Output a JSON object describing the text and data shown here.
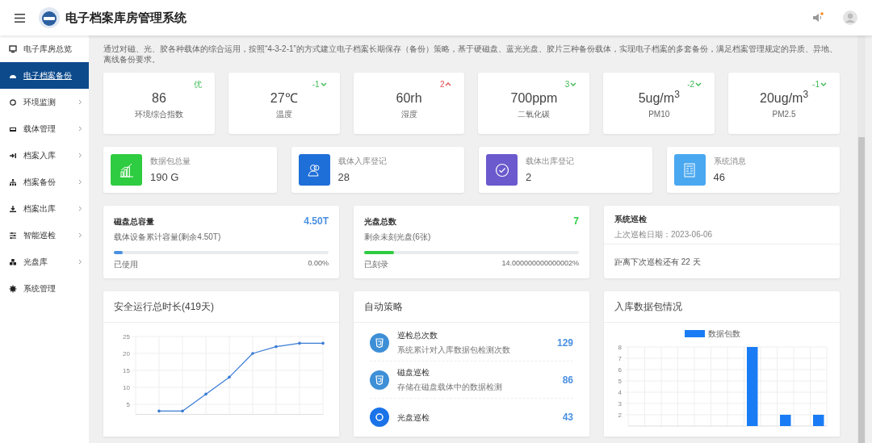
{
  "header": {
    "title": "电子档案库房管理系统"
  },
  "sidebar": {
    "items": [
      {
        "label": "电子库房总览",
        "selected": false,
        "submenu": false
      },
      {
        "label": "电子档案备份",
        "selected": true,
        "submenu": false
      },
      {
        "label": "环境监测",
        "selected": false,
        "submenu": true
      },
      {
        "label": "载体管理",
        "selected": false,
        "submenu": true
      },
      {
        "label": "档案入库",
        "selected": false,
        "submenu": true
      },
      {
        "label": "档案备份",
        "selected": false,
        "submenu": true
      },
      {
        "label": "档案出库",
        "selected": false,
        "submenu": true
      },
      {
        "label": "智能巡检",
        "selected": false,
        "submenu": true
      },
      {
        "label": "光盘库",
        "selected": false,
        "submenu": true
      },
      {
        "label": "系统管理",
        "selected": false,
        "submenu": false
      }
    ]
  },
  "intro": "通过对磁、光、胶各种载体的综合运用，按照“4-3-2-1”的方式建立电子档案长期保存（备份）策略，基于硬磁盘、蓝光光盘、胶片三种备份载体，实现电子档案的多套备份，满足档案管理规定的异质、异地、离线备份要求。",
  "env_cards": [
    {
      "value": "86",
      "label": "环境综合指数",
      "change": "优",
      "kind": "none"
    },
    {
      "value": "27℃",
      "label": "温度",
      "change": "-1",
      "kind": "down"
    },
    {
      "value": "60rh",
      "label": "湿度",
      "change": "2",
      "kind": "up"
    },
    {
      "value": "700ppm",
      "label": "二氧化碳",
      "change": "3",
      "kind": "down"
    },
    {
      "value": "5ug/m$^{3}$",
      "label": "PM10",
      "change": "-2",
      "kind": "down"
    },
    {
      "value": "20ug/m$^{3}$",
      "label": "PM2.5",
      "change": "-1",
      "kind": "down"
    }
  ],
  "stat_cards": [
    {
      "label": "数据包总量",
      "value": "190 G",
      "color": "#2ecc40"
    },
    {
      "label": "载体入库登记",
      "value": "28",
      "color": "#1f6fd8"
    },
    {
      "label": "载体出库登记",
      "value": "2",
      "color": "#6a5acd"
    },
    {
      "label": "系统消息",
      "value": "46",
      "color": "#4aa8f0"
    }
  ],
  "capacity_cards": [
    {
      "title": "磁盘总容量",
      "value": "4.50T",
      "color": "#4a90e2",
      "subtitle": "载体设备累计容量(剩余4.50T)",
      "level": 0.04,
      "left_label": "已使用",
      "right_label": "0.00%"
    },
    {
      "title": "光盘总数",
      "value": "7",
      "color": "#2ecc40",
      "subtitle": "剩余未刻光盘(6张)",
      "level": 0.14,
      "left_label": "已刻录",
      "right_label": "14.000000000000002%"
    }
  ],
  "patrol": {
    "title": "系统巡检",
    "last": "上次巡检日期：2023-06-06",
    "next": "距离下次巡检还有 22 天"
  },
  "safety_panel": {
    "title": "安全运行总时长(419天)",
    "chart_data": {
      "type": "line",
      "grid": true,
      "series": [
        {
          "color": "#3a7bd5",
          "values": [
            3,
            3,
            8,
            13,
            20,
            22,
            23,
            23
          ]
        }
      ],
      "yticks": [
        5,
        10,
        15,
        20,
        25
      ],
      "ylim": [
        2,
        25
      ]
    }
  },
  "strategy_panel": {
    "title": "自动策略",
    "items": [
      {
        "title": "巡检总次数",
        "desc": "系统累计对入库数据包检测次数",
        "value": "129",
        "kind": "html"
      },
      {
        "title": "磁盘巡检",
        "desc": "存储在磁盘载体中的数据检测",
        "value": "86",
        "kind": "html"
      },
      {
        "title": "光盘巡检",
        "value": "43",
        "kind": "disc"
      }
    ]
  },
  "package_panel": {
    "title": "入库数据包情况",
    "chart_data": {
      "type": "bar",
      "grid": true,
      "series": [
        {
          "name": "数据包数",
          "color": "#1a7cf5",
          "values": [
            null,
            null,
            null,
            null,
            null,
            null,
            null,
            8,
            null,
            2,
            null,
            2
          ]
        }
      ],
      "yticks": [
        2,
        3,
        4,
        5,
        6,
        7,
        8
      ],
      "ylim": [
        1,
        8
      ]
    }
  }
}
